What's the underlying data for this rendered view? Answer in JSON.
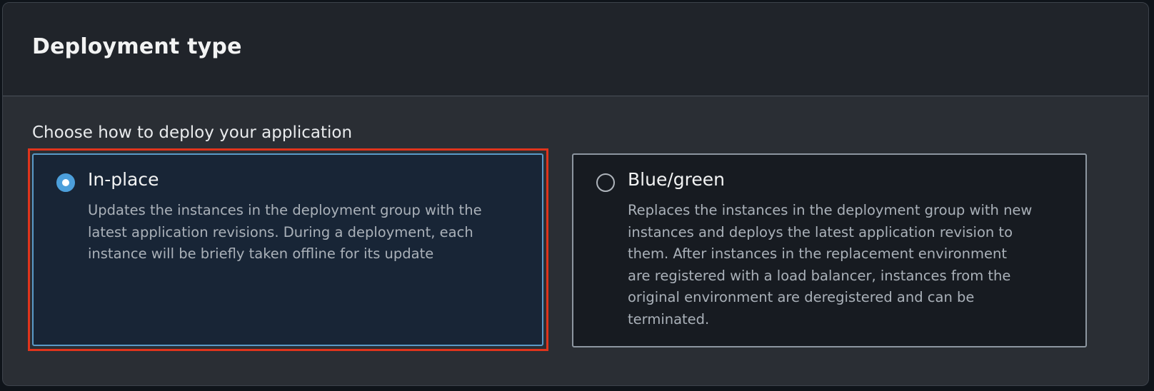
{
  "section": {
    "title": "Deployment type",
    "prompt": "Choose how to deploy your application"
  },
  "options": [
    {
      "label": "In-place",
      "selected": true,
      "description_lines": [
        "Updates the instances in the deployment group with the",
        "latest application revisions. During a deployment, each",
        "instance will be briefly taken offline for its update"
      ]
    },
    {
      "label": "Blue/green",
      "selected": false,
      "description_lines": [
        "Replaces the instances in the deployment group with new",
        "instances and deploys the latest application revision to",
        "them. After instances in the replacement environment",
        "are registered with a load balancer, instances from the",
        "original environment are deregistered and can be",
        "terminated."
      ]
    }
  ],
  "colors": {
    "selected_accent": "#4c9fdb",
    "highlight_outline": "#e0341c",
    "panel_background": "#2a2e34",
    "header_background": "#20242a"
  }
}
